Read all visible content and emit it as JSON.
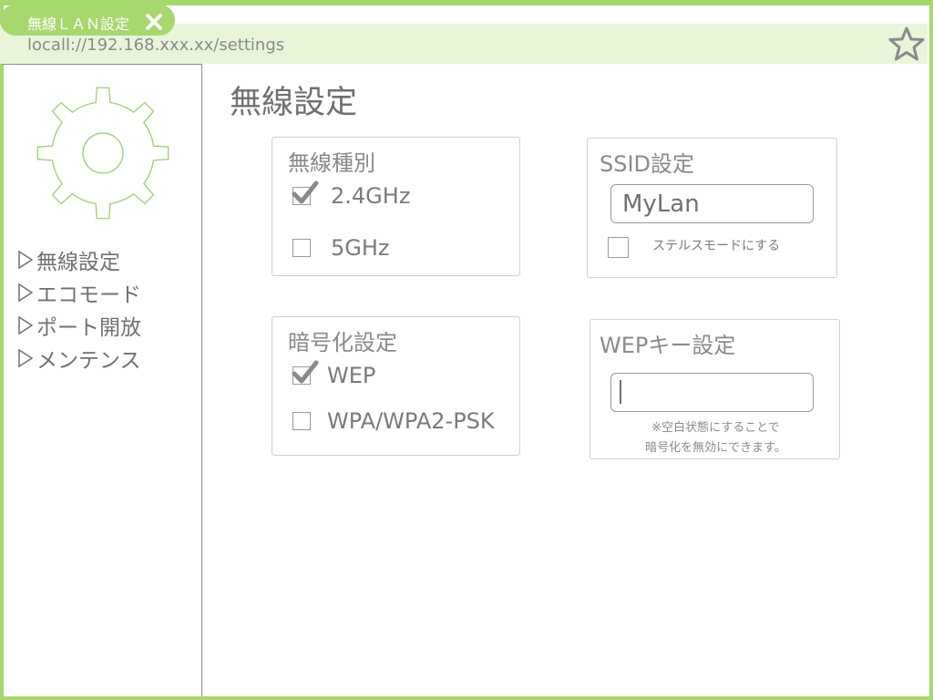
{
  "browser": {
    "tab_title": "無線ＬＡＮ設定",
    "address": "locall://192.168.xxx.xx/settings",
    "accent_color": "#a6d86e"
  },
  "sidebar": {
    "icon": "gear-icon",
    "items": [
      {
        "label": "無線設定"
      },
      {
        "label": "エコモード"
      },
      {
        "label": "ポート開放"
      },
      {
        "label": "メンテンス"
      }
    ]
  },
  "main": {
    "title": "無線設定",
    "wireless_type": {
      "title": "無線種別",
      "options": [
        {
          "label": "2.4GHz",
          "checked": true
        },
        {
          "label": "5GHz",
          "checked": false
        }
      ]
    },
    "ssid": {
      "title": "SSID設定",
      "value": "MyLan",
      "stealth_label": "ステルスモードにする",
      "stealth_checked": false
    },
    "encryption": {
      "title": "暗号化設定",
      "options": [
        {
          "label": "WEP",
          "checked": true
        },
        {
          "label": "WPA/WPA2-PSK",
          "checked": false
        }
      ]
    },
    "wep_key": {
      "title": "WEPキー設定",
      "value": "",
      "note_line1": "※空白状態にすることで",
      "note_line2": "暗号化を無効にできます。"
    }
  }
}
